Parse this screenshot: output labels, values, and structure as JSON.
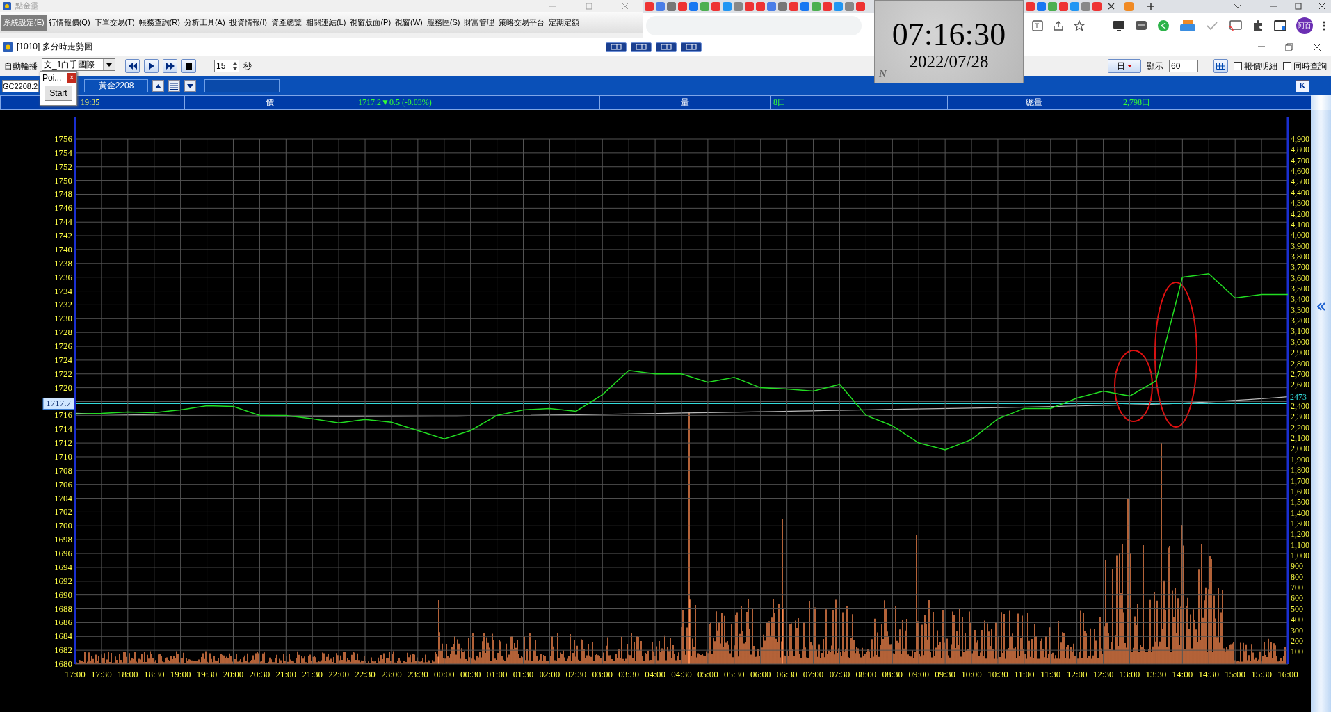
{
  "app_window": {
    "title": "點金靈",
    "menu": [
      {
        "label": "系統設定(E)",
        "selected": true
      },
      {
        "label": "行情報價(Q)",
        "selected": false
      },
      {
        "label": "下單交易(T)",
        "selected": false
      },
      {
        "label": "帳務查詢(R)",
        "selected": false
      },
      {
        "label": "分析工具(A)",
        "selected": false
      },
      {
        "label": "投資情報(I)",
        "selected": false
      },
      {
        "label": "資產總覽",
        "selected": false
      },
      {
        "label": "相關連結(L)",
        "selected": false
      },
      {
        "label": "視窗版面(P)",
        "selected": false
      },
      {
        "label": "視窗(W)",
        "selected": false
      },
      {
        "label": "服務區(S)",
        "selected": false
      },
      {
        "label": "財富管理",
        "selected": false
      },
      {
        "label": "策略交易平台",
        "selected": false
      },
      {
        "label": "定期定額",
        "selected": false
      }
    ]
  },
  "browser": {
    "profile": "阿百"
  },
  "clock": {
    "time": "07:16:30",
    "date": "2022/07/28",
    "badge": "N"
  },
  "chart_window": {
    "title": "[1010] 多分時走勢圖"
  },
  "toolbar": {
    "autoplay_label": "自動輪播",
    "group": "文_1白手國際",
    "interval": "15",
    "interval_unit": "秒",
    "period": "日",
    "display_label": "顯示",
    "display_count": "60",
    "checkboxes": [
      {
        "label": "報價明細",
        "checked": false
      },
      {
        "label": "同時查詢",
        "checked": false
      }
    ]
  },
  "symbol_bar": {
    "code": "GC2208.2",
    "name": "黃金2208",
    "k_button": "K"
  },
  "popup": {
    "title": "Poi...",
    "close": "×",
    "button": "Start"
  },
  "quote_header": {
    "time": "19:35",
    "price_label": "價",
    "price": "1717.2▼0.5 (-0.03%)",
    "volume_label": "量",
    "volume": "8口",
    "total_label": "總量",
    "total": "2,798口"
  },
  "chart": {
    "price_marker": "1717.7",
    "volume_marker": "2473",
    "volume_axis": [
      "4,900",
      "4,800",
      "4,700",
      "4,600",
      "4,500",
      "4,400",
      "4,300",
      "4,200",
      "4,100",
      "4,000",
      "3,900",
      "3,800",
      "3,700",
      "3,600",
      "3,500",
      "3,400",
      "3,300",
      "3,200",
      "3,100",
      "3,000",
      "2,900",
      "2,800",
      "2,700",
      "2,600",
      "2,400",
      "2,300",
      "2,200",
      "2,100",
      "2,000",
      "1,900",
      "1,800",
      "1,700",
      "1,600",
      "1,500",
      "1,400",
      "1,300",
      "1,200",
      "1,100",
      "1,000",
      "900",
      "800",
      "700",
      "600",
      "500",
      "400",
      "300",
      "200",
      "100"
    ],
    "chart_data": {
      "type": "line",
      "grid": true,
      "ylim": [
        1680,
        1756
      ],
      "yticks": [
        1756,
        1754,
        1752,
        1750,
        1748,
        1746,
        1744,
        1742,
        1740,
        1738,
        1736,
        1734,
        1732,
        1730,
        1728,
        1726,
        1724,
        1722,
        1720,
        1716,
        1714,
        1712,
        1710,
        1708,
        1706,
        1704,
        1702,
        1700,
        1698,
        1696,
        1694,
        1692,
        1690,
        1688,
        1686,
        1684,
        1682,
        1680
      ],
      "categories": [
        "17:00",
        "17:30",
        "18:00",
        "18:30",
        "19:00",
        "19:30",
        "20:00",
        "20:30",
        "21:00",
        "21:30",
        "22:00",
        "22:30",
        "23:00",
        "23:30",
        "00:00",
        "00:30",
        "01:00",
        "01:30",
        "02:00",
        "02:30",
        "03:00",
        "03:30",
        "04:00",
        "04:30",
        "05:00",
        "05:30",
        "06:00",
        "06:30",
        "07:00",
        "07:30",
        "08:00",
        "08:30",
        "09:00",
        "09:30",
        "10:00",
        "10:30",
        "11:00",
        "11:30",
        "12:00",
        "12:30",
        "13:00",
        "13:30",
        "14:00",
        "14:30",
        "15:00",
        "15:30",
        "16:00"
      ],
      "series": [
        {
          "color": "#22dd22",
          "values": [
            1716.2,
            1716.3,
            1716.5,
            1716.4,
            1716.8,
            1717.4,
            1717.3,
            1716.0,
            1716.0,
            1715.5,
            1714.9,
            1715.4,
            1715.0,
            1713.8,
            1712.6,
            1713.8,
            1716.0,
            1716.8,
            1717.0,
            1716.6,
            1719.0,
            1722.5,
            1722.0,
            1722.0,
            1720.8,
            1721.5,
            1720.0,
            1719.8,
            1719.5,
            1720.5,
            1716.0,
            1714.5,
            1712.0,
            1711.0,
            1712.5,
            1715.5,
            1717.0,
            1717.0,
            1718.5,
            1719.5,
            1718.8,
            1721.0,
            1736.0,
            1736.5,
            1733.0,
            1733.5,
            1733.5
          ]
        }
      ]
    }
  }
}
